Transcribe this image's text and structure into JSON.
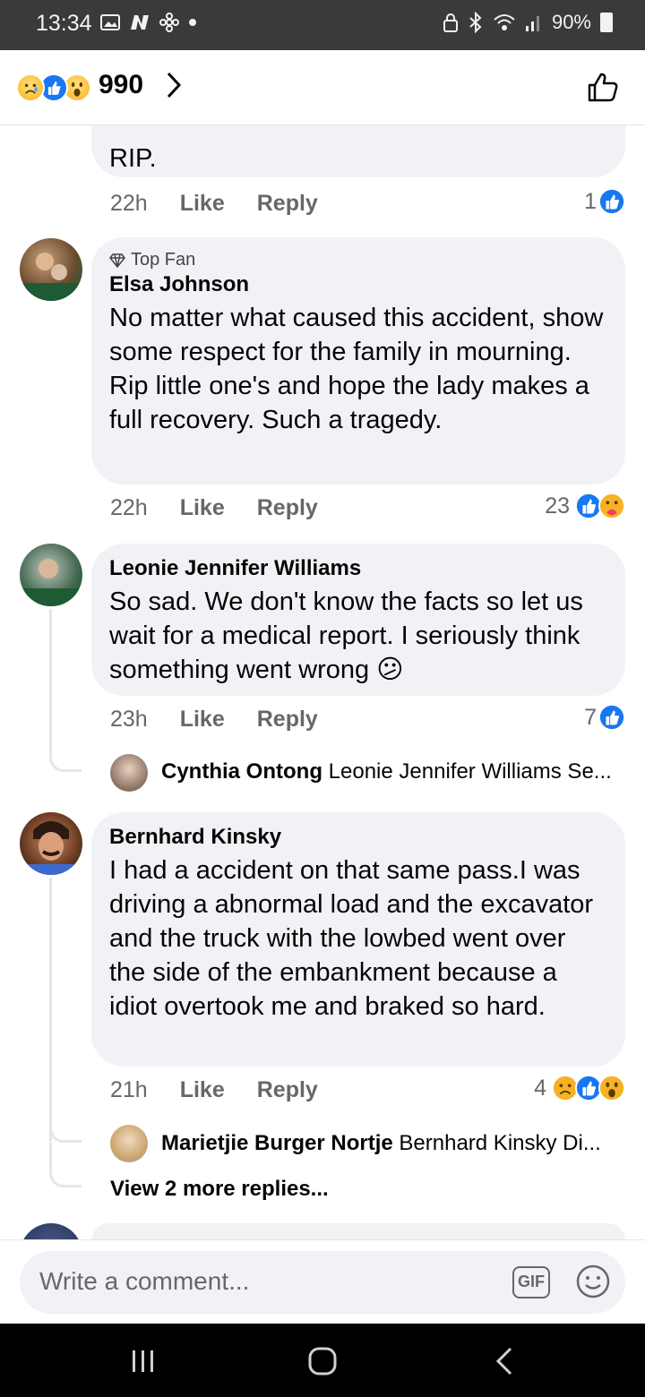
{
  "status_bar": {
    "time": "13:34",
    "battery": "90%",
    "left_icons": [
      "image-icon",
      "n-icon",
      "fan-icon",
      "dot-icon"
    ],
    "right_icons": [
      "lock-icon",
      "bluetooth-icon",
      "wifi-icon",
      "signal-icon",
      "battery-icon"
    ]
  },
  "header": {
    "reactions": [
      "sad",
      "like",
      "wow"
    ],
    "reaction_count": "990"
  },
  "comments": [
    {
      "id": "c0",
      "partial_text": "RIP.",
      "time": "22h",
      "like_label": "Like",
      "reply_label": "Reply",
      "reaction_count": "1",
      "reactions": [
        "like"
      ]
    },
    {
      "id": "c1",
      "badge": "Top Fan",
      "author": "Elsa Johnson",
      "text": "No matter what caused this accident, show some respect for the family in mourning. Rip little one's and hope the lady makes a full recovery. Such a tragedy.",
      "time": "22h",
      "like_label": "Like",
      "reply_label": "Reply",
      "reaction_count": "23",
      "reactions": [
        "like",
        "care"
      ]
    },
    {
      "id": "c2",
      "author": "Leonie Jennifer Williams",
      "text": "So sad. We don't know the facts so let us wait for a medical report. I seriously think something went wrong 😕",
      "time": "23h",
      "like_label": "Like",
      "reply_label": "Reply",
      "reaction_count": "7",
      "reactions": [
        "like"
      ],
      "reply_preview": {
        "author": "Cynthia Ontong",
        "snippet": "Leonie Jennifer Williams Se..."
      }
    },
    {
      "id": "c3",
      "author": "Bernhard Kinsky",
      "text": "I had a accident on that same pass.I was driving a abnormal load and the excavator and the truck with the  lowbed went over the side of the embankment because a idiot overtook me and braked so hard.",
      "time": "21h",
      "like_label": "Like",
      "reply_label": "Reply",
      "reaction_count": "4",
      "reactions": [
        "sad",
        "like",
        "wow"
      ],
      "reply_preview": {
        "author": "Marietjie Burger Nortje",
        "snippet": "Bernhard Kinsky Di..."
      },
      "more_replies": "View 2 more replies..."
    }
  ],
  "composer": {
    "placeholder": "Write a comment...",
    "gif_label": "GIF"
  },
  "colors": {
    "brand_blue": "#1877f2",
    "bubble_bg": "#f0f2f5",
    "meta_gray": "#65676b"
  }
}
